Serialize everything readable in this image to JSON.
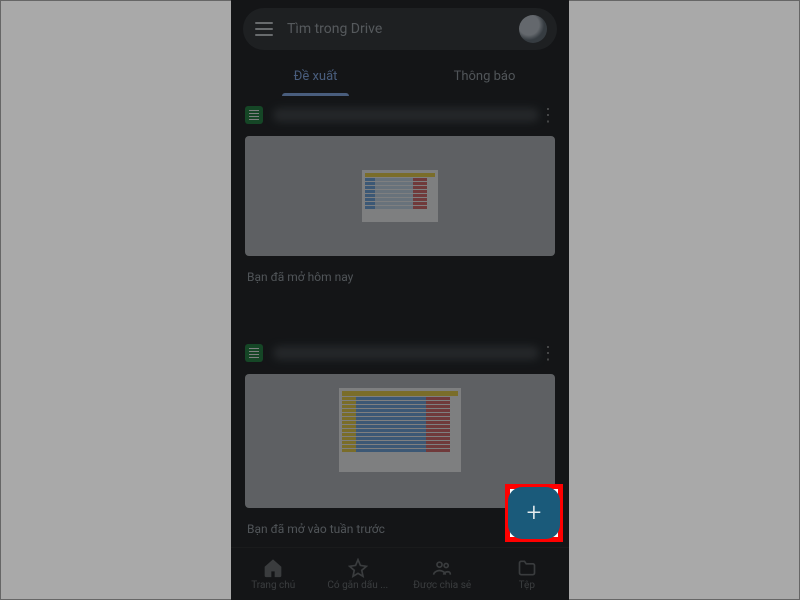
{
  "header": {
    "search_placeholder": "Tìm trong Drive"
  },
  "tabs": {
    "suggested": "Đề xuất",
    "notifications": "Thông báo"
  },
  "cards": [
    {
      "meta": "Bạn đã mở hôm nay"
    },
    {
      "meta": "Bạn đã mở vào tuần trước"
    }
  ],
  "nav": {
    "home": "Trang chủ",
    "starred": "Có gắn dấu ...",
    "shared": "Được chia sẻ",
    "files": "Tệp"
  },
  "fab": {
    "label": "+"
  }
}
